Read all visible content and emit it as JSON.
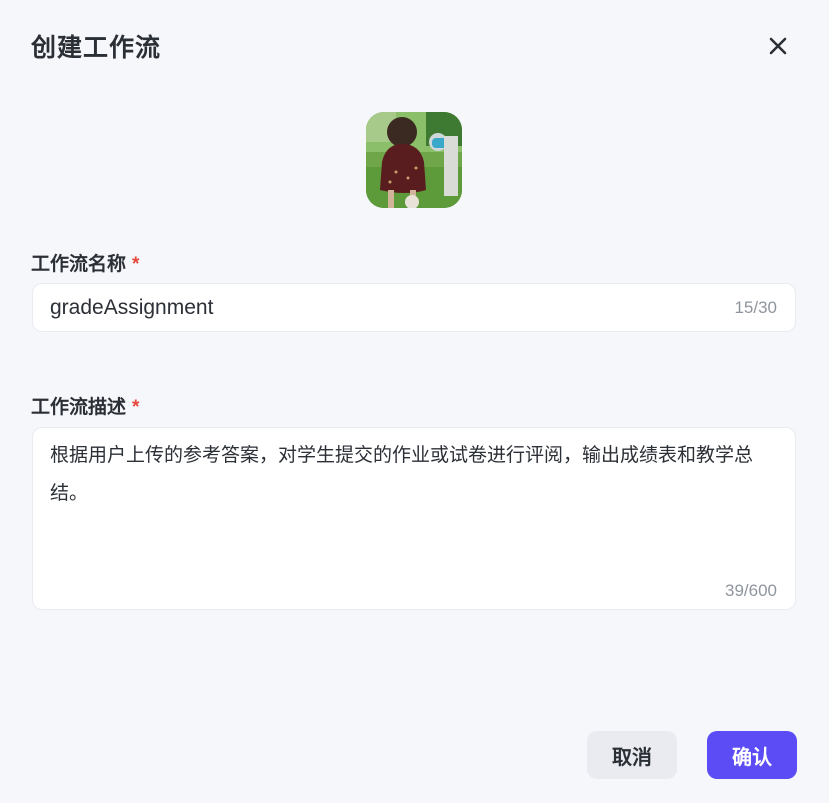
{
  "dialog": {
    "title": "创建工作流",
    "close_icon": "close-icon"
  },
  "avatar": {
    "icon": "workflow-avatar-image",
    "colors": {
      "grass": "#5f9a3e",
      "dress": "#5a1d1f",
      "hair": "#3a2a22"
    }
  },
  "fields": {
    "name": {
      "label": "工作流名称",
      "required_mark": "*",
      "value": "gradeAssignment",
      "counter": "15/30"
    },
    "description": {
      "label": "工作流描述",
      "required_mark": "*",
      "value": "根据用户上传的参考答案，对学生提交的作业或试卷进行评阅，输出成绩表和教学总结。",
      "counter": "39/600"
    }
  },
  "buttons": {
    "cancel": "取消",
    "confirm": "确认"
  },
  "colors": {
    "accent": "#5b4cf5",
    "required": "#e5483b",
    "background": "#f6f7fb",
    "muted_text": "#8f959e"
  }
}
